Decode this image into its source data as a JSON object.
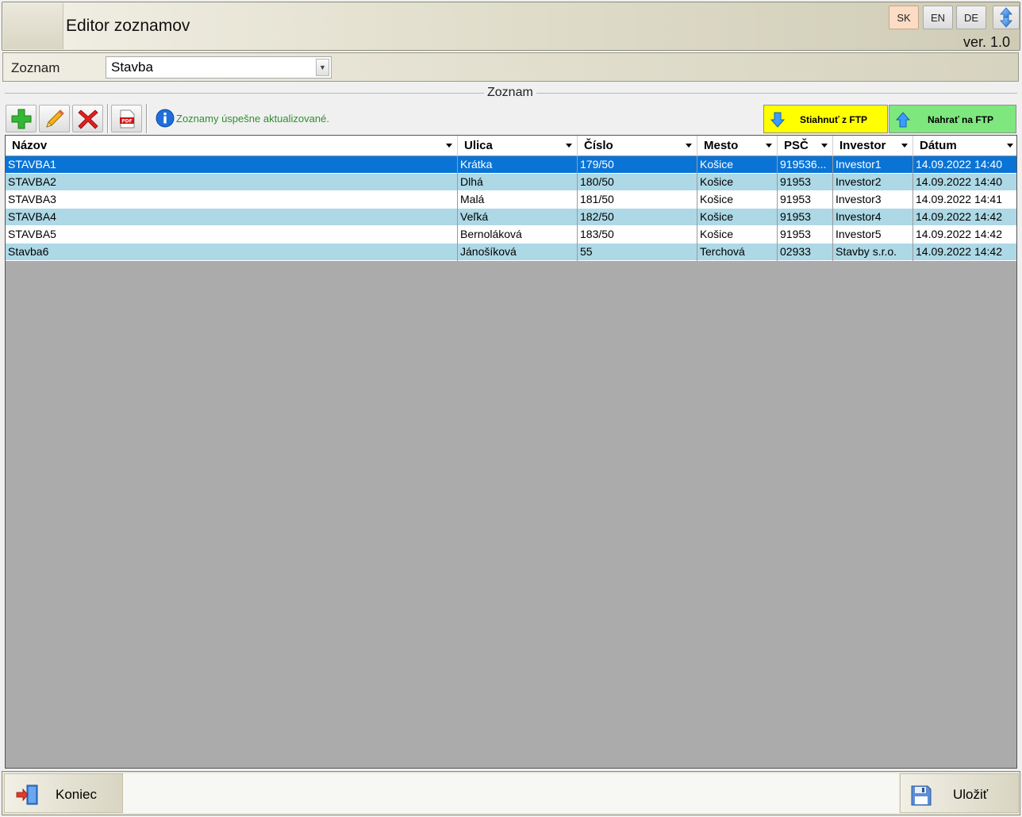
{
  "header": {
    "title": "Editor zoznamov",
    "version": "ver. 1.0",
    "languages": [
      "SK",
      "EN",
      "DE"
    ],
    "active_language": "SK"
  },
  "selector": {
    "label": "Zoznam",
    "value": "Stavba"
  },
  "group": {
    "caption": "Zoznam"
  },
  "toolbar": {
    "status_message": "Zoznamy úspešne aktualizované.",
    "download_label": "Stiahnuť z FTP",
    "upload_label": "Nahrať na FTP",
    "pdf_label": "PDF"
  },
  "grid": {
    "columns": [
      "Názov",
      "Ulica",
      "Číslo",
      "Mesto",
      "PSČ",
      "Investor",
      "Dátum"
    ],
    "rows": [
      [
        "STAVBA1",
        "Krátka",
        "179/50",
        "Košice",
        "919536...",
        "Investor1",
        "14.09.2022 14:40"
      ],
      [
        "STAVBA2",
        "Dlhá",
        "180/50",
        "Košice",
        "91953",
        "Investor2",
        "14.09.2022 14:40"
      ],
      [
        "STAVBA3",
        "Malá",
        "181/50",
        "Košice",
        "91953",
        "Investor3",
        "14.09.2022 14:41"
      ],
      [
        "STAVBA4",
        "Veľká",
        "182/50",
        "Košice",
        "91953",
        "Investor4",
        "14.09.2022 14:42"
      ],
      [
        "STAVBA5",
        "Bernoláková",
        "183/50",
        "Košice",
        "91953",
        "Investor5",
        "14.09.2022 14:42"
      ],
      [
        "Stavba6",
        "Jánošíková",
        "55",
        "Terchová",
        "02933",
        "Stavby s.r.o.",
        "14.09.2022 14:42"
      ]
    ],
    "selected_row": 0
  },
  "footer": {
    "exit_label": "Koniec",
    "save_label": "Uložiť"
  },
  "colors": {
    "selected_row": "#0a74d6",
    "alt_row": "#add8e6",
    "download_button": "#ffff00",
    "upload_button": "#7ee87e",
    "status_text": "#2f8f2f"
  }
}
